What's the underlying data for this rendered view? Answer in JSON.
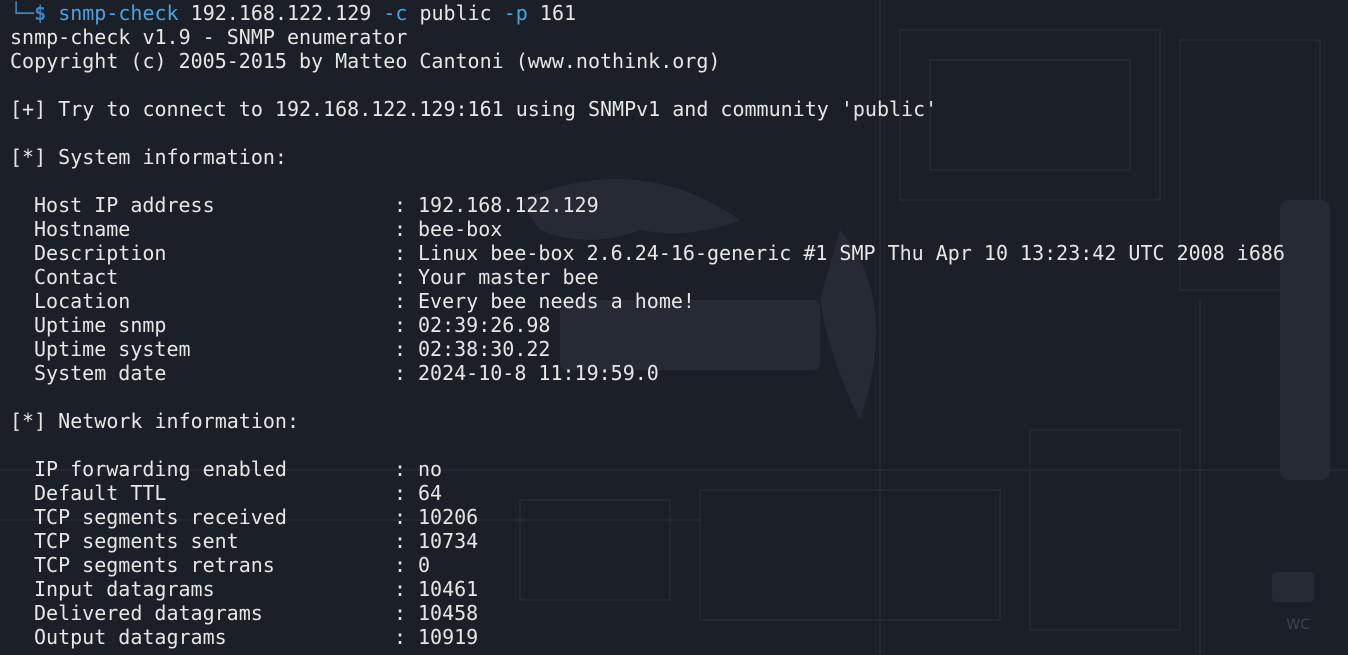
{
  "terminal": {
    "prompt": {
      "corner": "└─",
      "dollar": "$",
      "command": "snmp-check",
      "target": "192.168.122.129",
      "flag_community": "-c",
      "community": "public",
      "flag_port": "-p",
      "port": "161"
    },
    "banner_line1": "snmp-check v1.9 - SNMP enumerator",
    "banner_line2": "Copyright (c) 2005-2015 by Matteo Cantoni (www.nothink.org)",
    "connect_line": "[+] Try to connect to 192.168.122.129:161 using SNMPv1 and community 'public'",
    "system_header": "[*] System information:",
    "system_info": [
      {
        "key": "Host IP address",
        "value": "192.168.122.129"
      },
      {
        "key": "Hostname",
        "value": "bee-box"
      },
      {
        "key": "Description",
        "value": "Linux bee-box 2.6.24-16-generic #1 SMP Thu Apr 10 13:23:42 UTC 2008 i686"
      },
      {
        "key": "Contact",
        "value": "Your master bee"
      },
      {
        "key": "Location",
        "value": "Every bee needs a home!"
      },
      {
        "key": "Uptime snmp",
        "value": "02:39:26.98"
      },
      {
        "key": "Uptime system",
        "value": "02:38:30.22"
      },
      {
        "key": "System date",
        "value": "2024-10-8 11:19:59.0"
      }
    ],
    "network_header": "[*] Network information:",
    "network_info": [
      {
        "key": "IP forwarding enabled",
        "value": "no"
      },
      {
        "key": "Default TTL",
        "value": "64"
      },
      {
        "key": "TCP segments received",
        "value": "10206"
      },
      {
        "key": "TCP segments sent",
        "value": "10734"
      },
      {
        "key": "TCP segments retrans",
        "value": "0"
      },
      {
        "key": "Input datagrams",
        "value": "10461"
      },
      {
        "key": "Delivered datagrams",
        "value": "10458"
      },
      {
        "key": "Output datagrams",
        "value": "10919"
      }
    ],
    "separator": ":"
  },
  "wallpaper": {
    "corner_label": "WC"
  },
  "colors": {
    "background": "#1b1f27",
    "text": "#e6e6e6",
    "command": "#4aa3df",
    "prompt": "#3a86c8"
  }
}
